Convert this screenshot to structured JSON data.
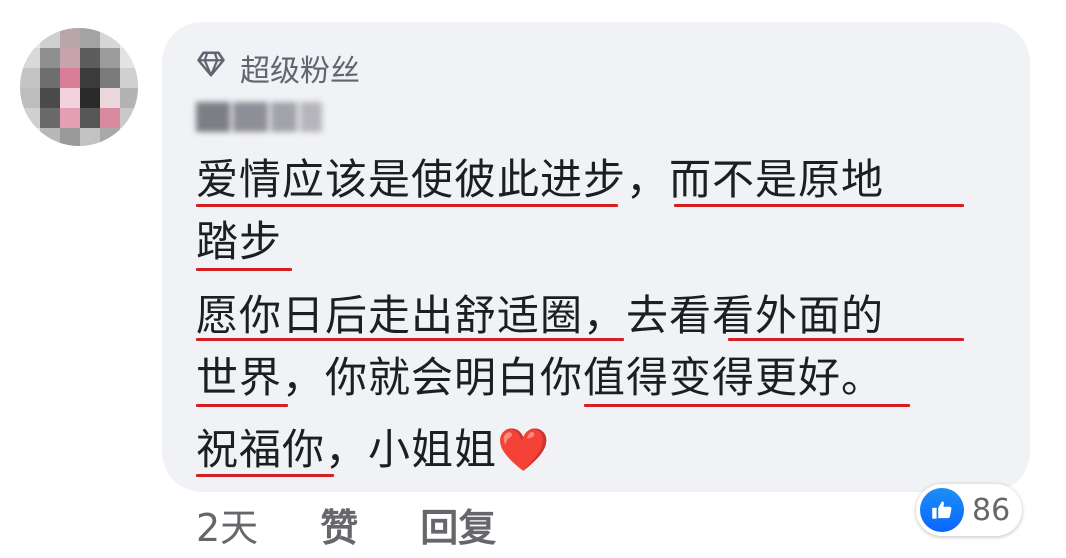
{
  "comment": {
    "badge_label": "超级粉丝",
    "badge_icon": "diamond-icon",
    "lines": [
      "爱情应该是使彼此进步，而不是原地",
      "踏步",
      "愿你日后走出舒适圈，去看看外面的",
      "世界，你就会明白你值得变得更好。",
      "祝福你，小姐姐"
    ],
    "heart_emoji": "❤️"
  },
  "footer": {
    "time": "2天",
    "like_label": "赞",
    "reply_label": "回复"
  },
  "reactions": {
    "icon": "thumbs-up-icon",
    "count": "86"
  },
  "colors": {
    "bubble": "#f0f2f5",
    "underline": "#d42020",
    "like_blue": "#0866ff",
    "meta_text": "#65676b"
  }
}
